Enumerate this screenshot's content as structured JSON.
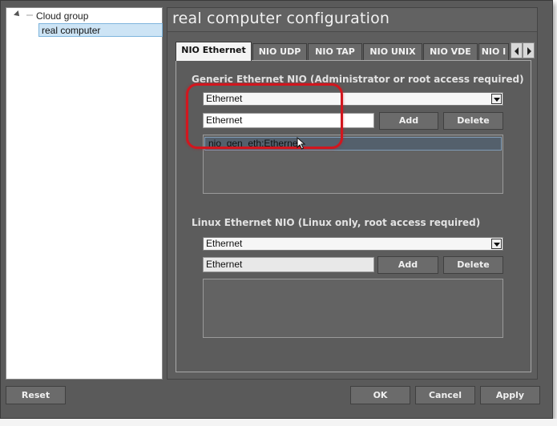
{
  "tree": {
    "group_label": "Cloud group",
    "child_label": "real computer"
  },
  "config": {
    "title": "real computer configuration",
    "tabs": [
      {
        "label": "NIO Ethernet",
        "active": true
      },
      {
        "label": "NIO UDP",
        "active": false
      },
      {
        "label": "NIO TAP",
        "active": false
      },
      {
        "label": "NIO UNIX",
        "active": false
      },
      {
        "label": "NIO VDE",
        "active": false
      },
      {
        "label": "NIO I",
        "active": false
      }
    ],
    "generic": {
      "label": "Generic Ethernet NIO (Administrator or root access required)",
      "combo_value": "Ethernet",
      "input_value": "Ethernet",
      "add_label": "Add",
      "delete_label": "Delete",
      "items": [
        "nio_gen_eth:Ethernet"
      ]
    },
    "linux": {
      "label": "Linux Ethernet NIO (Linux only, root access required)",
      "combo_value": "Ethernet",
      "input_value": "Ethernet",
      "add_label": "Add",
      "delete_label": "Delete",
      "items": []
    }
  },
  "buttons": {
    "reset": "Reset",
    "ok": "OK",
    "cancel": "Cancel",
    "apply": "Apply"
  },
  "colors": {
    "highlight": "#d2161e",
    "window_bg": "#5a5a5a",
    "selection": "#cde4f5"
  }
}
